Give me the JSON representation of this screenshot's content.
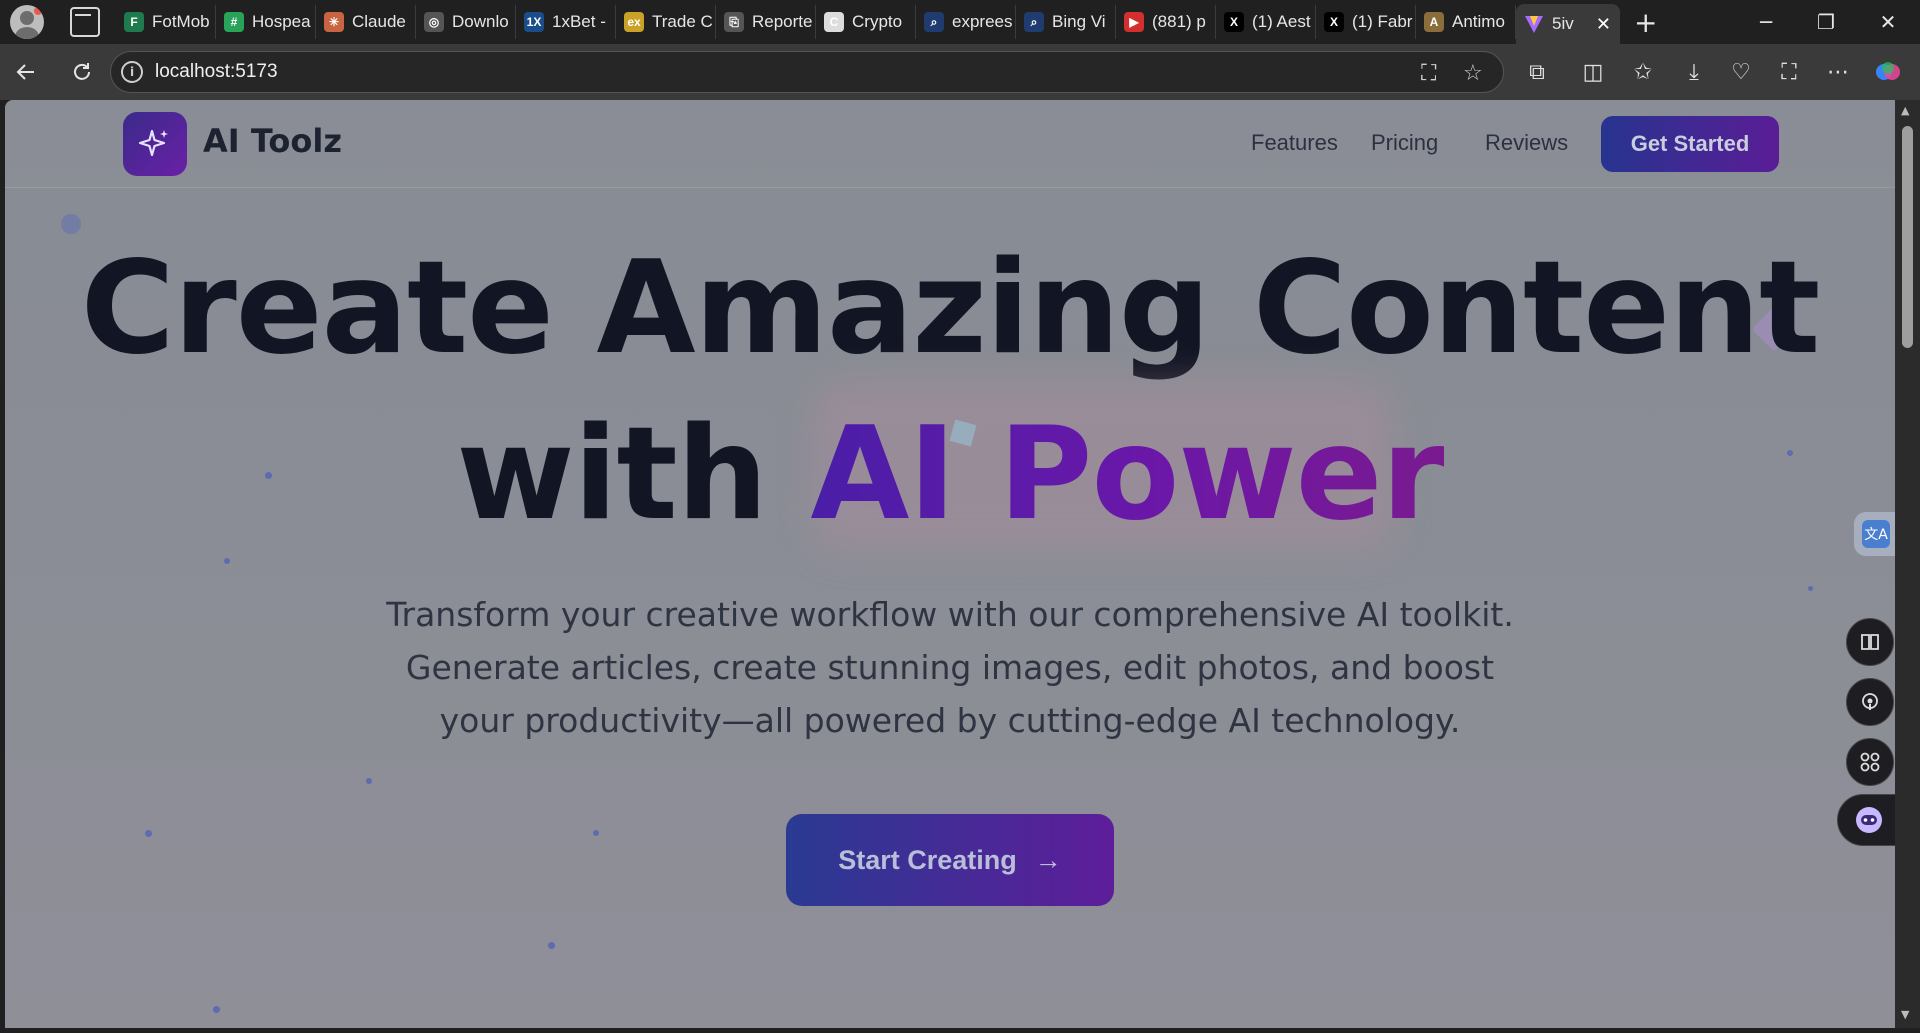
{
  "browser": {
    "tabs": [
      {
        "label": "FotMob",
        "color": "#1f7a4d",
        "glyph": "F"
      },
      {
        "label": "Hospea",
        "color": "#2aa35a",
        "glyph": "#"
      },
      {
        "label": "Claude",
        "color": "#c96442",
        "glyph": "✳"
      },
      {
        "label": "Downlo",
        "color": "#555555",
        "glyph": "◎"
      },
      {
        "label": "1xBet -",
        "color": "#1a4e8a",
        "glyph": "1X"
      },
      {
        "label": "Trade C",
        "color": "#c9a227",
        "glyph": "ex"
      },
      {
        "label": "Reporte",
        "color": "#555555",
        "glyph": "⎘"
      },
      {
        "label": "Crypto",
        "color": "#dddddd",
        "glyph": "C"
      },
      {
        "label": "exprees",
        "color": "#1f3b70",
        "glyph": "⌕"
      },
      {
        "label": "Bing Vi",
        "color": "#1f3b70",
        "glyph": "⌕"
      },
      {
        "label": "(881) p",
        "color": "#d32f2f",
        "glyph": "▶"
      },
      {
        "label": "(1) Aest",
        "color": "#000000",
        "glyph": "X"
      },
      {
        "label": "(1) Fabr",
        "color": "#000000",
        "glyph": "X"
      },
      {
        "label": "Antimo",
        "color": "#8a6d3b",
        "glyph": "A"
      }
    ],
    "active_tab": {
      "label": "5iv",
      "close": "✕"
    },
    "new_tab": "+",
    "window_controls": {
      "minimize": "─",
      "restore": "❐",
      "close": "✕"
    },
    "address": "localhost:5173"
  },
  "site": {
    "logo": "AI Toolz",
    "nav": [
      "Features",
      "Pricing",
      "Reviews"
    ],
    "cta": "Get Started",
    "hero": {
      "line1": "Create Amazing Content",
      "line2_prefix": "with ",
      "line2_highlight": "AI Power"
    },
    "subtext": "Transform your creative workflow with our comprehensive AI toolkit. Generate articles, create stunning images, edit photos, and boost your productivity—all powered by cutting-edge AI technology.",
    "start_button": "Start Creating",
    "start_arrow": "→"
  },
  "extensions": {
    "translate_glyph": "文A",
    "fab_icons": [
      "book-icon",
      "podcast-icon",
      "apps-icon",
      "assistant-icon"
    ]
  }
}
